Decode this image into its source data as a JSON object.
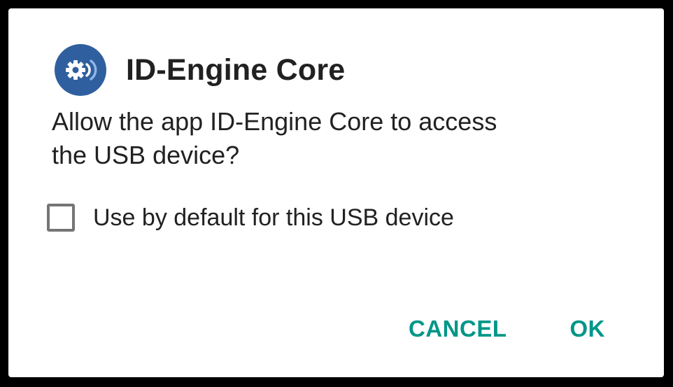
{
  "dialog": {
    "app_icon": "gear-wireless-icon",
    "title": "ID-Engine Core",
    "message_line1": "Allow the app ID-Engine Core to access",
    "message_line2": "the USB device?",
    "checkbox": {
      "label": "Use by default for this USB device",
      "checked": false
    },
    "buttons": {
      "cancel_label": "CANCEL",
      "ok_label": "OK"
    }
  },
  "colors": {
    "accent": "#009688",
    "icon_background": "#2f5f9e",
    "text": "#212121",
    "checkbox_border": "#757575"
  }
}
